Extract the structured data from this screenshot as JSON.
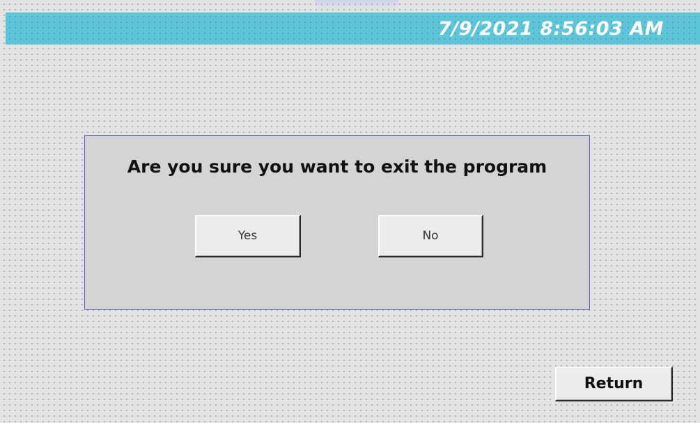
{
  "header": {
    "datetime": "7/9/2021 8:56:03 AM"
  },
  "dialog": {
    "message": "Are you sure you want to exit the program",
    "yes_label": "Yes",
    "no_label": "No"
  },
  "footer": {
    "return_label": "Return"
  },
  "colors": {
    "header_bar": "#5ec6d8",
    "background": "#e4e4e4",
    "dialog_background": "#d4d4d4",
    "dialog_border": "#5a5ad0"
  }
}
